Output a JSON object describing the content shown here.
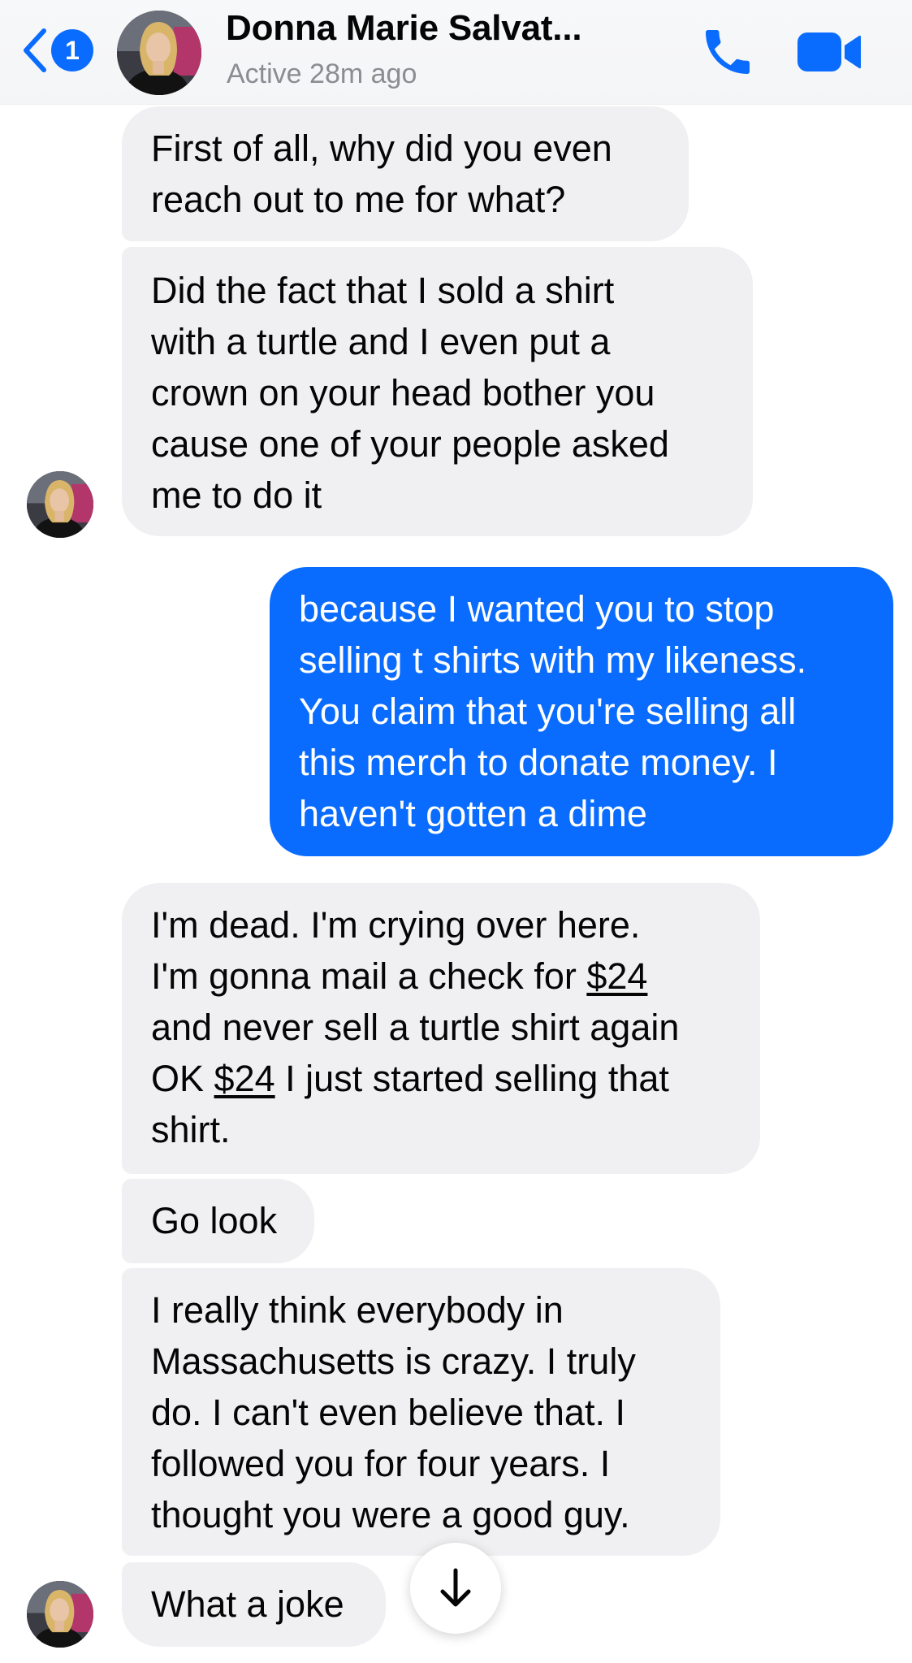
{
  "header": {
    "back_badge": "1",
    "contact_name": "Donna Marie Salvat...",
    "status": "Active 28m ago",
    "back_icon": "chevron-left-icon",
    "call_icon": "phone-icon",
    "video_icon": "video-camera-icon"
  },
  "messages": [
    {
      "sender": "contact",
      "lines": [
        "First of all, why did you even",
        "reach out to me for what?"
      ]
    },
    {
      "sender": "contact",
      "lines": [
        "Did the fact that I sold a shirt",
        "with a turtle and I even put a",
        "crown on your head bother you",
        "cause one of your people asked",
        "me to do it"
      ]
    },
    {
      "sender": "me",
      "lines": [
        "because I wanted you to stop",
        "selling t shirts with my likeness.",
        "You claim that you're selling all",
        "this merch to donate money. I",
        "haven't gotten a dime"
      ]
    },
    {
      "sender": "contact",
      "lines": [
        "I'm dead. I'm crying over here.",
        "I'm gonna mail a check for",
        "$24",
        "and never sell a turtle shirt again",
        "OK",
        "$24",
        "I just started selling that",
        "shirt."
      ]
    },
    {
      "sender": "contact",
      "lines": [
        "Go look"
      ]
    },
    {
      "sender": "contact",
      "lines": [
        "I really think everybody in",
        "Massachusetts is crazy. I truly",
        "do. I can't even believe that. I",
        "followed you for four years. I",
        "thought you were a good guy."
      ]
    },
    {
      "sender": "contact",
      "lines": [
        "What a joke"
      ]
    }
  ],
  "colors": {
    "outgoing_bubble": "#0a6cff",
    "incoming_bubble": "#f0f0f2",
    "accent": "#0a6cff",
    "status_text": "#8a8d91"
  },
  "scroll_button_icon": "arrow-down-icon"
}
